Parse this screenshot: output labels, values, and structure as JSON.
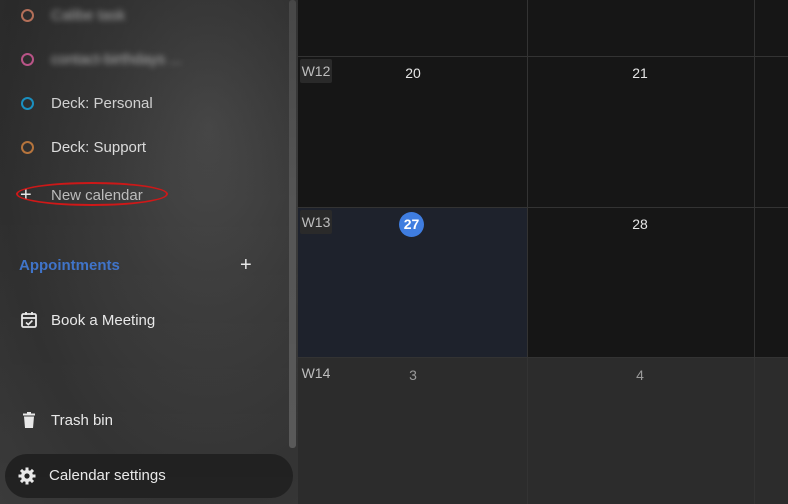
{
  "sidebar": {
    "calendars": [
      {
        "label": "Calibe task",
        "color": "#e0876a"
      },
      {
        "label": "contact-birthdays ...",
        "color": "#d95f9d"
      },
      {
        "label": "Deck: Personal",
        "color": "#1a9fd6"
      },
      {
        "label": "Deck: Support",
        "color": "#c07a3f"
      }
    ],
    "new_calendar_label": "New calendar",
    "appointments_heading": "Appointments",
    "book_meeting_label": "Book a Meeting",
    "trash_label": "Trash bin",
    "settings_label": "Calendar settings"
  },
  "calendar": {
    "weeks": [
      {
        "label": "W12",
        "days": [
          "20",
          "21"
        ]
      },
      {
        "label": "W13",
        "days": [
          "27",
          "28"
        ]
      },
      {
        "label": "W14",
        "days": [
          "3",
          "4"
        ]
      }
    ],
    "today": "27",
    "colors": {
      "today_bg": "#3f7de0",
      "today_cell": "#1e222c",
      "accent": "#3f73c9",
      "highlight_ring": "#d01818"
    }
  }
}
